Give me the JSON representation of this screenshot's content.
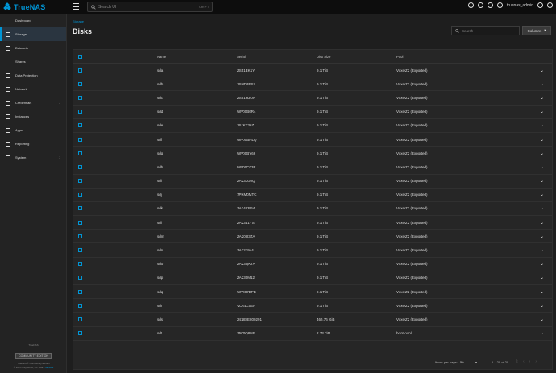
{
  "topbar": {
    "logo_text": "TrueNAS",
    "search_placeholder": "Search UI",
    "search_shortcut": "Ctrl + /",
    "username": "truenas_admin"
  },
  "sidebar": {
    "items": [
      {
        "label": "Dashboard",
        "icon": "dashboard-icon"
      },
      {
        "label": "Storage",
        "icon": "storage-icon",
        "active": true
      },
      {
        "label": "Datasets",
        "icon": "datasets-icon"
      },
      {
        "label": "Shares",
        "icon": "shares-icon"
      },
      {
        "label": "Data Protection",
        "icon": "data-protection-icon"
      },
      {
        "label": "Network",
        "icon": "network-icon"
      },
      {
        "label": "Credentials",
        "icon": "credentials-icon",
        "chevron": true
      },
      {
        "label": "Instances",
        "icon": "instances-icon"
      },
      {
        "label": "Apps",
        "icon": "apps-icon"
      },
      {
        "label": "Reporting",
        "icon": "reporting-icon"
      },
      {
        "label": "System",
        "icon": "system-icon",
        "chevron": true
      }
    ],
    "footer": {
      "small": "TrueNAS",
      "badge": "COMMUNITY EDITION",
      "line1": "TrueNAS® Community Edition",
      "line2_prefix": "© 2025 iXsystems, Inc. dba ",
      "line2_link": "TrueNAS"
    }
  },
  "main": {
    "breadcrumb": "Storage",
    "title": "Disks",
    "search_placeholder": "Search",
    "columns_label": "Columns"
  },
  "table": {
    "headers": {
      "name": "Name",
      "serial": "Serial",
      "size": "Disk Size",
      "pool": "Pool"
    },
    "rows": [
      {
        "name": "sda",
        "serial": "ZS51EK1Y",
        "size": "9.1 TiB",
        "pool": "VoxelZ2 (Exported)"
      },
      {
        "name": "sdb",
        "serial": "1SHD3ESZ",
        "size": "9.1 TiB",
        "pool": "VoxelZ2 (Exported)"
      },
      {
        "name": "sdc",
        "serial": "ZS51H3ON",
        "size": "9.1 TiB",
        "pool": "VoxelZ2 (Exported)"
      },
      {
        "name": "sdd",
        "serial": "WP00B6R4",
        "size": "9.1 TiB",
        "pool": "VoxelZ2 (Exported)"
      },
      {
        "name": "sde",
        "serial": "1SJKT36Z",
        "size": "9.1 TiB",
        "pool": "VoxelZ2 (Exported)"
      },
      {
        "name": "sdf",
        "serial": "WP00BHLQ",
        "size": "9.1 TiB",
        "pool": "VoxelZ2 (Exported)"
      },
      {
        "name": "sdg",
        "serial": "WP00BY66",
        "size": "9.1 TiB",
        "pool": "VoxelZ2 (Exported)"
      },
      {
        "name": "sdh",
        "serial": "WP00C03F",
        "size": "9.1 TiB",
        "pool": "VoxelZ2 (Exported)"
      },
      {
        "name": "sdi",
        "serial": "ZA23JG0Q",
        "size": "9.1 TiB",
        "pool": "VoxelZ2 (Exported)"
      },
      {
        "name": "sdj",
        "serial": "7PKM0MTC",
        "size": "9.1 TiB",
        "pool": "VoxelZ2 (Exported)"
      },
      {
        "name": "sdk",
        "serial": "ZA24CR64",
        "size": "9.1 TiB",
        "pool": "VoxelZ2 (Exported)"
      },
      {
        "name": "sdl",
        "serial": "ZA23L1YS",
        "size": "9.1 TiB",
        "pool": "VoxelZ2 (Exported)"
      },
      {
        "name": "sdm",
        "serial": "ZA20Q3ZA",
        "size": "9.1 TiB",
        "pool": "VoxelZ2 (Exported)"
      },
      {
        "name": "sdn",
        "serial": "ZA227944",
        "size": "9.1 TiB",
        "pool": "VoxelZ2 (Exported)"
      },
      {
        "name": "sdo",
        "serial": "ZA23QKTA",
        "size": "9.1 TiB",
        "pool": "VoxelZ2 (Exported)"
      },
      {
        "name": "sdp",
        "serial": "ZA230M12",
        "size": "9.1 TiB",
        "pool": "VoxelZ2 (Exported)"
      },
      {
        "name": "sdq",
        "serial": "WP007BPB",
        "size": "9.1 TiB",
        "pool": "VoxelZ2 (Exported)"
      },
      {
        "name": "sdr",
        "serial": "VCGLL0EP",
        "size": "9.1 TiB",
        "pool": "VoxelZ2 (Exported)"
      },
      {
        "name": "sds",
        "serial": "2418SE800291",
        "size": "465.76 GiB",
        "pool": "VoxelZ2 (Exported)"
      },
      {
        "name": "sdt",
        "serial": "Z500Q8NE",
        "size": "2.73 TiB",
        "pool": "boot-pool"
      }
    ]
  },
  "pager": {
    "items_per_page_label": "Items per page:",
    "items_per_page_value": "50",
    "range": "1 – 20 of 20"
  },
  "colors": {
    "accent": "#0095d5",
    "background": "#1e1e1e",
    "card": "#262626"
  }
}
